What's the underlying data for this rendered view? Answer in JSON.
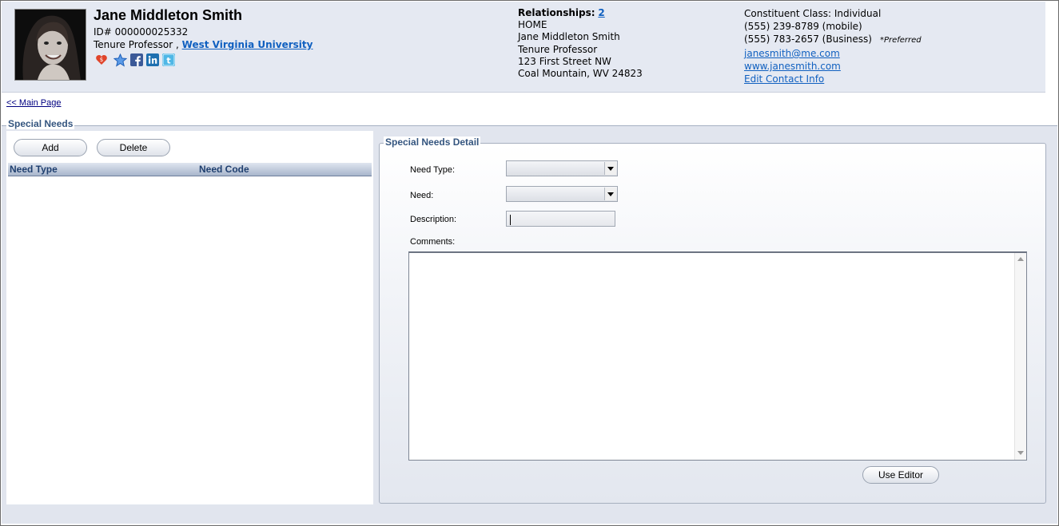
{
  "profile": {
    "name": "Jane Middleton Smith",
    "id_line": "ID# 000000025332",
    "title": "Tenure Professor ,",
    "institution": "West Virginia University"
  },
  "icons": [
    "heart-icon",
    "star-icon",
    "facebook-icon",
    "linkedin-icon",
    "twitter-icon"
  ],
  "relationships": {
    "label": "Relationships:",
    "count": "2",
    "address_type": "HOME",
    "contact_name": "Jane Middleton Smith",
    "contact_title": "Tenure Professor",
    "street": "123 First Street NW",
    "city_line": "Coal Mountain, WV 24823"
  },
  "contact": {
    "constituent_class": "Constituent Class: Individual",
    "phone_mobile": "(555) 239-8789 (mobile)",
    "phone_business": "(555) 783-2657 (Business)",
    "preferred_note": "*Preferred",
    "email": "janesmith@me.com",
    "website": "www.janesmith.com",
    "edit_link": "Edit Contact Info"
  },
  "nav": {
    "main_page_link": "<< Main Page"
  },
  "special_needs": {
    "section_title": "Special Needs",
    "add_label": "Add",
    "delete_label": "Delete",
    "columns": [
      "Need Type",
      "Need Code"
    ],
    "rows": []
  },
  "detail": {
    "section_title": "Special Needs Detail",
    "need_type_label": "Need Type:",
    "need_type_value": "",
    "need_label": "Need:",
    "need_value": "",
    "description_label": "Description:",
    "description_value": "",
    "comments_label": "Comments:",
    "comments_value": "",
    "use_editor_label": "Use Editor"
  },
  "colors": {
    "header_bg": "#e5e9f2",
    "section_title": "#34557f",
    "link": "#1060c0"
  }
}
